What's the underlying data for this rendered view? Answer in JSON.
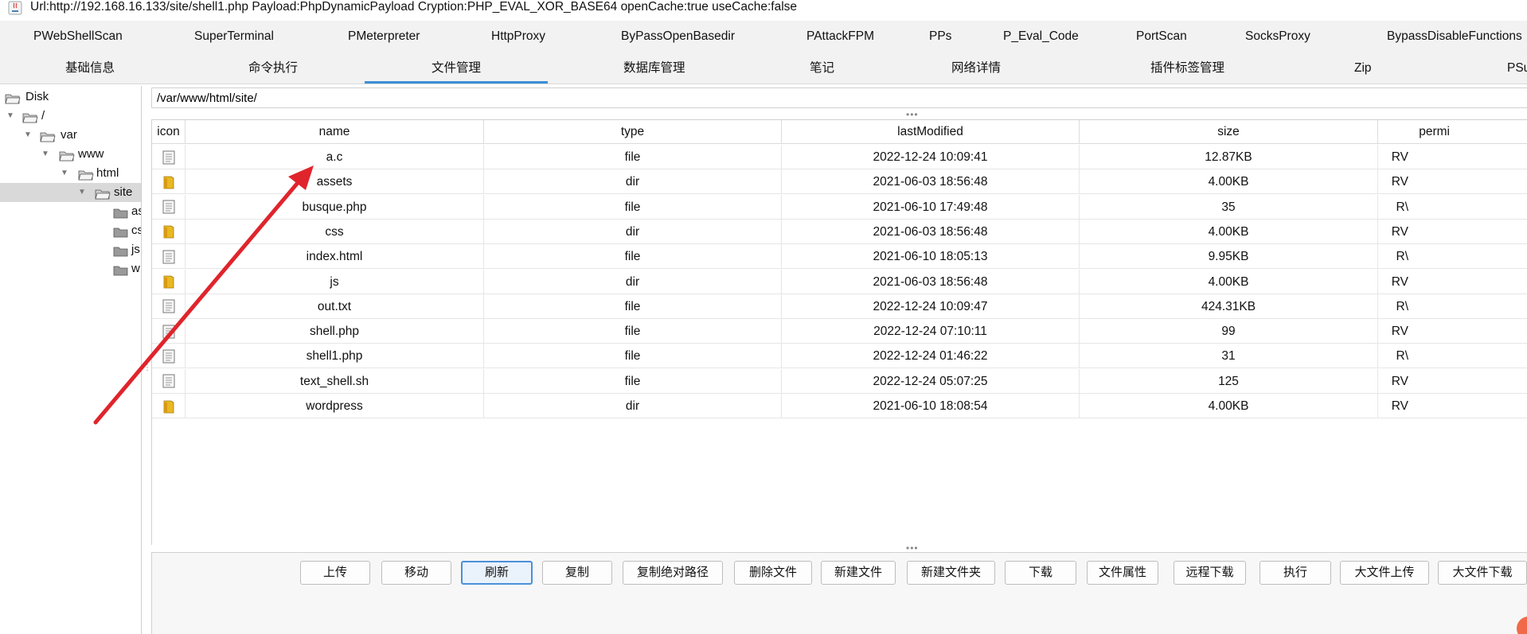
{
  "window": {
    "title": "Url:http://192.168.16.133/site/shell1.php Payload:PhpDynamicPayload Cryption:PHP_EVAL_XOR_BASE64 openCache:true useCache:false"
  },
  "plugins": [
    "PWebShellScan",
    "SuperTerminal",
    "PMeterpreter",
    "HttpProxy",
    "ByPassOpenBasedir",
    "PAttackFPM",
    "PPs",
    "P_Eval_Code",
    "PortScan",
    "SocksProxy",
    "BypassDisableFunctions"
  ],
  "tabs": [
    "基础信息",
    "命令执行",
    "文件管理",
    "数据库管理",
    "笔记",
    "网络详情",
    "插件标签管理",
    "Zip",
    "PSu"
  ],
  "active_tab": "文件管理",
  "tree": [
    "Disk",
    "/",
    "var",
    "www",
    "html",
    "site",
    "as",
    "cs",
    "js",
    "w"
  ],
  "path": "/var/www/html/site/",
  "table": {
    "headers": [
      "icon",
      "name",
      "type",
      "lastModified",
      "size",
      "permi"
    ],
    "rows": [
      {
        "name": "a.c",
        "type": "file",
        "lastModified": "2022-12-24 10:09:41",
        "size": "12.87KB",
        "perm": "RV"
      },
      {
        "name": "assets",
        "type": "dir",
        "lastModified": "2021-06-03 18:56:48",
        "size": "4.00KB",
        "perm": "RV"
      },
      {
        "name": "busque.php",
        "type": "file",
        "lastModified": "2021-06-10 17:49:48",
        "size": "35",
        "perm": "R\\"
      },
      {
        "name": "css",
        "type": "dir",
        "lastModified": "2021-06-03 18:56:48",
        "size": "4.00KB",
        "perm": "RV"
      },
      {
        "name": "index.html",
        "type": "file",
        "lastModified": "2021-06-10 18:05:13",
        "size": "9.95KB",
        "perm": "R\\"
      },
      {
        "name": "js",
        "type": "dir",
        "lastModified": "2021-06-03 18:56:48",
        "size": "4.00KB",
        "perm": "RV"
      },
      {
        "name": "out.txt",
        "type": "file",
        "lastModified": "2022-12-24 10:09:47",
        "size": "424.31KB",
        "perm": "R\\"
      },
      {
        "name": "shell.php",
        "type": "file",
        "lastModified": "2022-12-24 07:10:11",
        "size": "99",
        "perm": "RV"
      },
      {
        "name": "shell1.php",
        "type": "file",
        "lastModified": "2022-12-24 01:46:22",
        "size": "31",
        "perm": "R\\"
      },
      {
        "name": "text_shell.sh",
        "type": "file",
        "lastModified": "2022-12-24 05:07:25",
        "size": "125",
        "perm": "RV"
      },
      {
        "name": "wordpress",
        "type": "dir",
        "lastModified": "2021-06-10 18:08:54",
        "size": "4.00KB",
        "perm": "RV"
      }
    ]
  },
  "buttons": [
    "上传",
    "移动",
    "刷新",
    "复制",
    "复制绝对路径",
    "删除文件",
    "新建文件",
    "新建文件夹",
    "下载",
    "文件属性",
    "远程下载",
    "执行",
    "大文件上传",
    "大文件下载"
  ],
  "focused_button": "刷新",
  "icons": {
    "file": "document-icon",
    "dir": "folder-icon"
  },
  "colors": {
    "accent": "#3d8fd6",
    "folder": "#e8b923",
    "arrow": "#e0242c"
  }
}
